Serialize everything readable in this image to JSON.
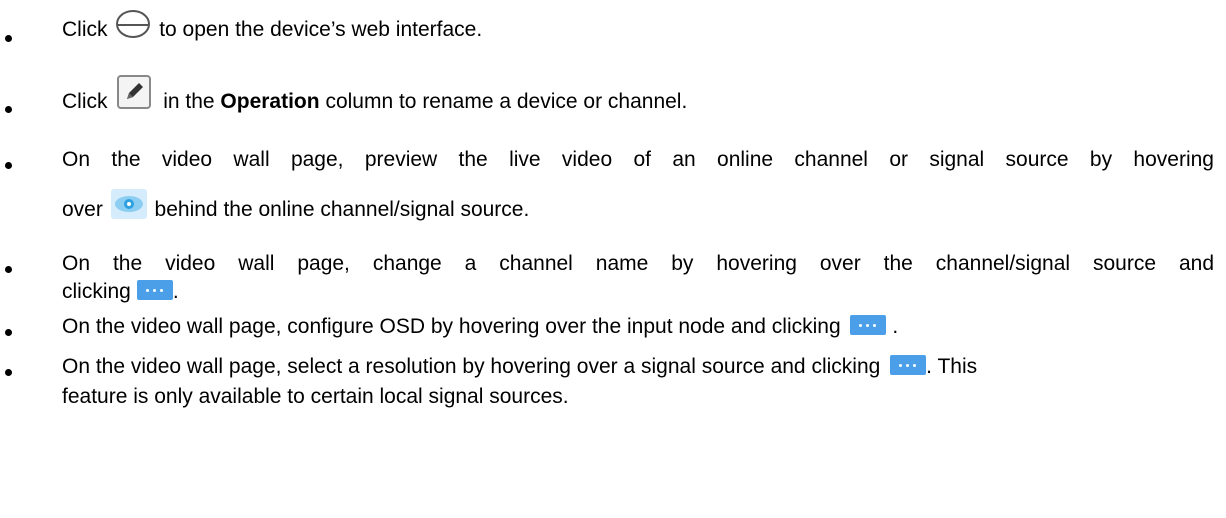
{
  "bullets": [
    {
      "pre": "Click",
      "post": "to open the device’s web interface.",
      "icon": "browser-e-icon"
    },
    {
      "pre": "Click",
      "mid_bold": "Operation",
      "post_a": "in the",
      "post_b": "column to rename a device or channel.",
      "icon": "edit-pencil-icon"
    },
    {
      "line1": "On the video wall page, preview the live video of an online channel or signal source by hovering",
      "line2_pre": "over",
      "line2_post": "behind the online channel/signal source.",
      "icon": "eye-preview-icon"
    },
    {
      "line1": "On the video wall page, change a channel name by hovering over the channel/signal source and",
      "line2_pre": "clicking",
      "line2_post": ".",
      "icon": "more-dots-icon"
    },
    {
      "pre": "On the video wall page, configure OSD by hovering over the input node and clicking",
      "post": ".",
      "icon": "more-dots-icon"
    },
    {
      "line1_pre": "On the video wall page, select a resolution by hovering over a signal source and clicking",
      "line1_post": ". This",
      "line2": "feature is only available to certain local signal sources.",
      "icon": "more-dots-icon"
    }
  ]
}
